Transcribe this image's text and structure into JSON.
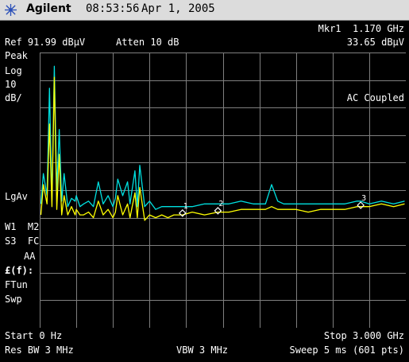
{
  "header": {
    "brand": "Agilent",
    "time": "08:53:56",
    "date": "Apr 1, 2005"
  },
  "marker": {
    "readout": "Mkr1  1.170 GHz",
    "amplitude": "33.65 dBμV",
    "labels": [
      "1",
      "2",
      "3"
    ]
  },
  "ref": {
    "ref_level": "Ref 91.99 dBμV",
    "atten": "Atten 10 dB"
  },
  "left_panel": {
    "peak": "Peak",
    "log": "Log",
    "scale_value": "10",
    "scale_unit": "dB/",
    "lgav": "LgAv",
    "w1m2": "W1  M2",
    "s3fc": "S3  FC",
    "aa": "AA",
    "ff": "£(f):",
    "ftun": "FTun",
    "swp": "Swp"
  },
  "annotation": {
    "coupling": "AC Coupled"
  },
  "footer": {
    "start": "Start 0 Hz",
    "stop": "Stop 3.000 GHz",
    "res_bw": "Res BW 3 MHz",
    "vbw": "VBW 3 MHz",
    "sweep": "Sweep 5 ms (601 pts)"
  },
  "colors": {
    "trace1": "#00e0e0",
    "trace2": "#ffff00",
    "grid": "#7f7f7f",
    "background": "#000000"
  },
  "chart_data": {
    "type": "line",
    "x_range_ghz": [
      0,
      3.0
    ],
    "reference_level_dbuv": 91.99,
    "scale_db_per_div": 10,
    "divisions": {
      "x": 10,
      "y": 10
    },
    "markers": [
      {
        "label": "1",
        "x_ghz": 1.17,
        "y_dbuv": 33.65
      },
      {
        "label": "2",
        "x_ghz": 1.46,
        "y_dbuv": 34.5
      },
      {
        "label": "3",
        "x_ghz": 2.63,
        "y_dbuv": 36.5
      }
    ],
    "series": [
      {
        "color": "#00e0e0",
        "x": [
          0.01,
          0.03,
          0.06,
          0.08,
          0.1,
          0.12,
          0.14,
          0.16,
          0.18,
          0.2,
          0.23,
          0.26,
          0.29,
          0.3,
          0.33,
          0.36,
          0.4,
          0.44,
          0.48,
          0.52,
          0.56,
          0.6,
          0.62,
          0.64,
          0.68,
          0.72,
          0.74,
          0.78,
          0.8,
          0.82,
          0.86,
          0.9,
          0.95,
          1.0,
          1.05,
          1.1,
          1.17,
          1.25,
          1.35,
          1.46,
          1.55,
          1.65,
          1.75,
          1.85,
          1.9,
          1.95,
          2.0,
          2.1,
          2.2,
          2.3,
          2.4,
          2.5,
          2.6,
          2.63,
          2.7,
          2.8,
          2.9,
          2.99
        ],
        "y": [
          37,
          48,
          40,
          79,
          38,
          87,
          42,
          64,
          38,
          48,
          36,
          39,
          38,
          40,
          36,
          37,
          38,
          36,
          45,
          37,
          40,
          36,
          39,
          46,
          40,
          45,
          37,
          49,
          36,
          51,
          36,
          38,
          35,
          36,
          36,
          36,
          36,
          36,
          37,
          37,
          37,
          38,
          37,
          37,
          44,
          38,
          37,
          37,
          37,
          37,
          37,
          37,
          38,
          38,
          37,
          38,
          37,
          38
        ]
      },
      {
        "color": "#ffff00",
        "x": [
          0.01,
          0.03,
          0.06,
          0.08,
          0.1,
          0.12,
          0.14,
          0.16,
          0.18,
          0.2,
          0.23,
          0.26,
          0.29,
          0.3,
          0.33,
          0.36,
          0.4,
          0.44,
          0.48,
          0.52,
          0.56,
          0.6,
          0.62,
          0.64,
          0.68,
          0.72,
          0.74,
          0.78,
          0.8,
          0.82,
          0.86,
          0.9,
          0.95,
          1.0,
          1.05,
          1.1,
          1.17,
          1.25,
          1.35,
          1.46,
          1.55,
          1.65,
          1.75,
          1.85,
          1.9,
          1.95,
          2.0,
          2.1,
          2.2,
          2.3,
          2.4,
          2.5,
          2.6,
          2.63,
          2.7,
          2.8,
          2.9,
          2.99
        ],
        "y": [
          33,
          44,
          37,
          66,
          36,
          83,
          35,
          55,
          33,
          40,
          33,
          36,
          33,
          35,
          33,
          33,
          34,
          32,
          38,
          33,
          35,
          32,
          34,
          40,
          33,
          37,
          32,
          41,
          32,
          43,
          31,
          33,
          32,
          33,
          32,
          33,
          33,
          34,
          33,
          34,
          34,
          35,
          35,
          35,
          36,
          35,
          35,
          35,
          34,
          35,
          35,
          35,
          36,
          36,
          36,
          37,
          36,
          37
        ]
      }
    ]
  }
}
